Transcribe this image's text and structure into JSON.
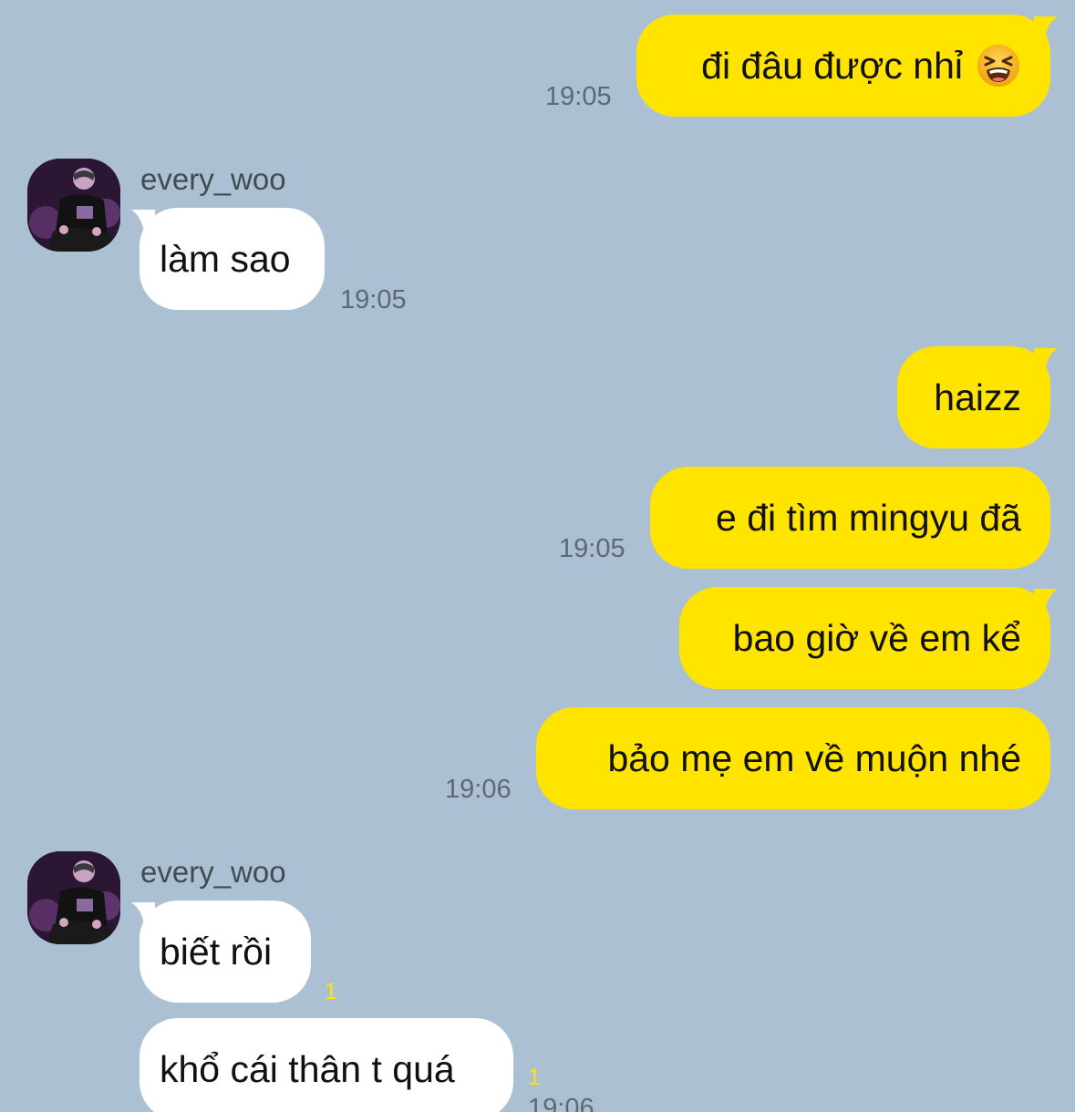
{
  "messages": [
    {
      "text": "đi đâu được nhỉ",
      "emoji": "tired-face-emoji",
      "time": "19:05"
    },
    {
      "sender": "every_woo",
      "text": "làm sao",
      "time": "19:05"
    },
    {
      "text": "haizz"
    },
    {
      "text": "e đi tìm mingyu đã",
      "time": "19:05"
    },
    {
      "text": "bao giờ về em kể"
    },
    {
      "text": "bảo mẹ em về muộn nhé",
      "time": "19:06"
    },
    {
      "sender": "every_woo",
      "text": "biết rồi",
      "unread": "1"
    },
    {
      "text": "khổ cái thân t quá",
      "unread": "1",
      "time": "19:06"
    }
  ],
  "colors": {
    "background": "#abc1d3",
    "my_bubble": "#ffe400",
    "their_bubble": "#ffffff",
    "timestamp": "#5d6973",
    "unread_count": "#ffe400"
  }
}
